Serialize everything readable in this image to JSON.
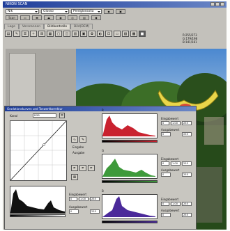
{
  "window": {
    "title": "NIKON SCAN"
  },
  "toolbar": {
    "source": "Nik",
    "mode": "Glosso",
    "preset": "Pentglossolia",
    "buttons": [
      "◆",
      "▣"
    ],
    "scan_label": "Scan"
  },
  "tabs": [
    {
      "label": "Lage"
    },
    {
      "label": "Vorscannen"
    },
    {
      "label": "Bildkontrolle"
    },
    {
      "label": "Bild(DEM)"
    }
  ],
  "tools": [
    "▤",
    "✎",
    "☰",
    "✧",
    "⊞",
    "▦",
    "▢",
    "◫",
    "▥",
    "▣",
    "✿",
    "◐",
    "⊡",
    "▭",
    "▧",
    "▩",
    "■"
  ],
  "readout": {
    "line1": "R:255/273",
    "line2": "G:179/198",
    "line3": "B:141/161"
  },
  "dialog": {
    "title": "Gradationskurven und Tonwertkorrektur",
    "channel_label": "Kanal",
    "channel_value": "RGB",
    "eingabe": "Eingabe",
    "ausgabe": "Ausgabe",
    "gray_point_label": "Eingabewert",
    "output_label": "Ausgabewert",
    "main_values": [
      "0",
      "1.00",
      "255"
    ],
    "main_output": [
      "0",
      "255"
    ],
    "channels": [
      {
        "name": "R",
        "input": [
          "0",
          "1.00",
          "255"
        ],
        "output": [
          "0",
          "255"
        ]
      },
      {
        "name": "G",
        "input": [
          "0",
          "1.00",
          "255"
        ],
        "output": [
          "0",
          "255"
        ]
      },
      {
        "name": "B",
        "input": [
          "0",
          "1.00",
          "255"
        ],
        "output": [
          "0",
          "255"
        ]
      }
    ]
  },
  "colors": {
    "red": "#c9222f",
    "green": "#3e9a3b",
    "blue": "#4b2a9a",
    "black": "#111111"
  }
}
